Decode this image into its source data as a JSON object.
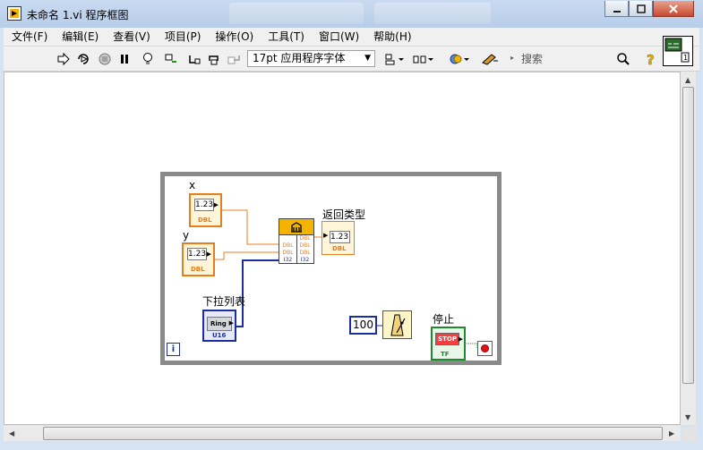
{
  "window": {
    "title": "未命名 1.vi 程序框图",
    "app_icon": "labview-diagram-icon",
    "buttons": {
      "minimize": "minimize-icon",
      "maximize": "maximize-icon",
      "close": "close-icon"
    }
  },
  "menu": {
    "items": [
      "文件(F)",
      "编辑(E)",
      "查看(V)",
      "项目(P)",
      "操作(O)",
      "工具(T)",
      "窗口(W)",
      "帮助(H)"
    ]
  },
  "toolbar": {
    "font_select": "17pt 应用程序字体",
    "search_placeholder": "搜索",
    "icons": [
      "run-arrow-icon",
      "run-continuously-icon",
      "abort-icon",
      "pause-icon",
      "highlight-execution-icon",
      "retain-wire-values-icon",
      "step-into-icon",
      "step-over-icon",
      "step-out-icon",
      "align-objects-icon",
      "distribute-objects-icon",
      "reorder-icon",
      "clean-up-diagram-icon",
      "search-icon",
      "help-icon"
    ]
  },
  "diagram": {
    "controls": {
      "x": {
        "label": "x",
        "value": "1.23",
        "type_tag": "DBL"
      },
      "y": {
        "label": "y",
        "value": "1.23",
        "type_tag": "DBL"
      },
      "ring": {
        "label": "下拉列表",
        "text": "Ring",
        "type_tag": "U16"
      },
      "stop": {
        "label": "停止",
        "text": "STOP",
        "type_tag": "TF"
      }
    },
    "indicators": {
      "return_type": {
        "label": "返回类型",
        "value": "1.23",
        "type_tag": "DBL"
      }
    },
    "formula_node": {
      "rows_left": [
        "",
        "DBL",
        "DBL",
        "I32"
      ],
      "rows_right": [
        "DBL",
        "DBL",
        "DBL",
        "I32"
      ]
    },
    "constant": {
      "value": "100"
    },
    "iteration_terminal": "i",
    "colors": {
      "dbl": "#e87d1e",
      "int": "#1d2fa0",
      "bool": "#1c8a2d",
      "loop": "#8a8a8a"
    }
  }
}
